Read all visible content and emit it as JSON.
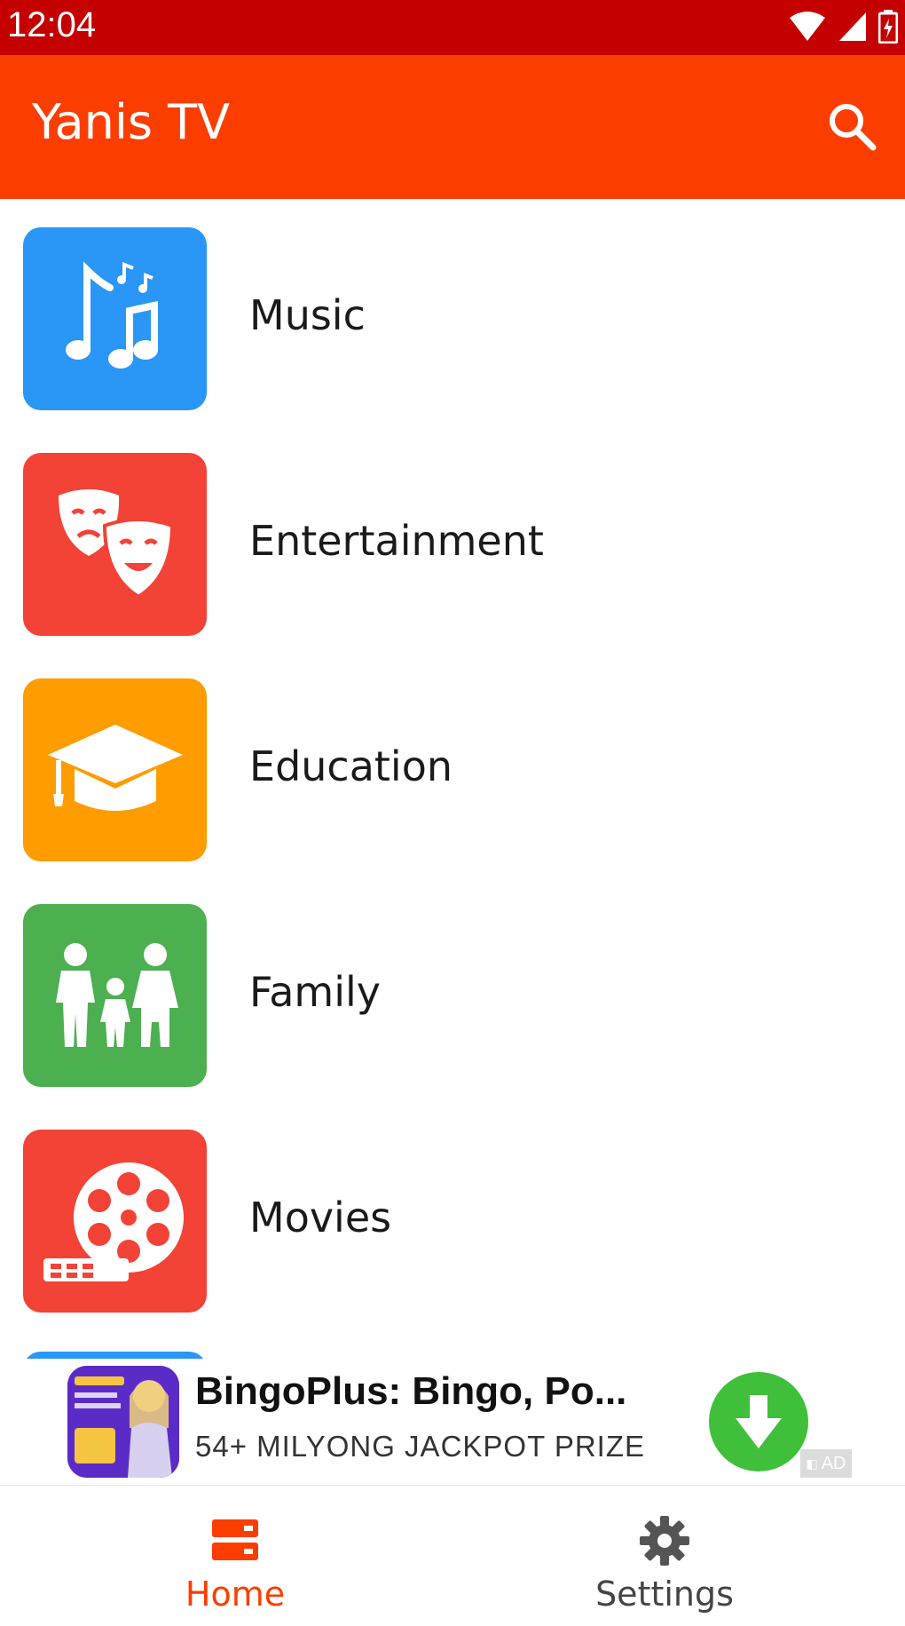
{
  "status_bar": {
    "time": "12:04"
  },
  "app_bar": {
    "title": "Yanis TV"
  },
  "categories": [
    {
      "label": "Music",
      "color": "#2a96f5",
      "icon": "music-note-icon"
    },
    {
      "label": "Entertainment",
      "color": "#f34236",
      "icon": "theater-masks-icon"
    },
    {
      "label": "Education",
      "color": "#fe9c00",
      "icon": "graduation-cap-icon"
    },
    {
      "label": "Family",
      "color": "#4caf50",
      "icon": "family-icon"
    },
    {
      "label": "Movies",
      "color": "#f34236",
      "icon": "film-reel-icon"
    }
  ],
  "ad": {
    "title": "BingoPlus: Bingo, Po...",
    "subtitle": "54+ MILYONG JACKPOT PRIZE",
    "badge": "AD",
    "download_color": "#3fbf3a"
  },
  "bottom_nav": {
    "home_label": "Home",
    "settings_label": "Settings",
    "active_color": "#fb3e00",
    "inactive_color": "#444444"
  }
}
